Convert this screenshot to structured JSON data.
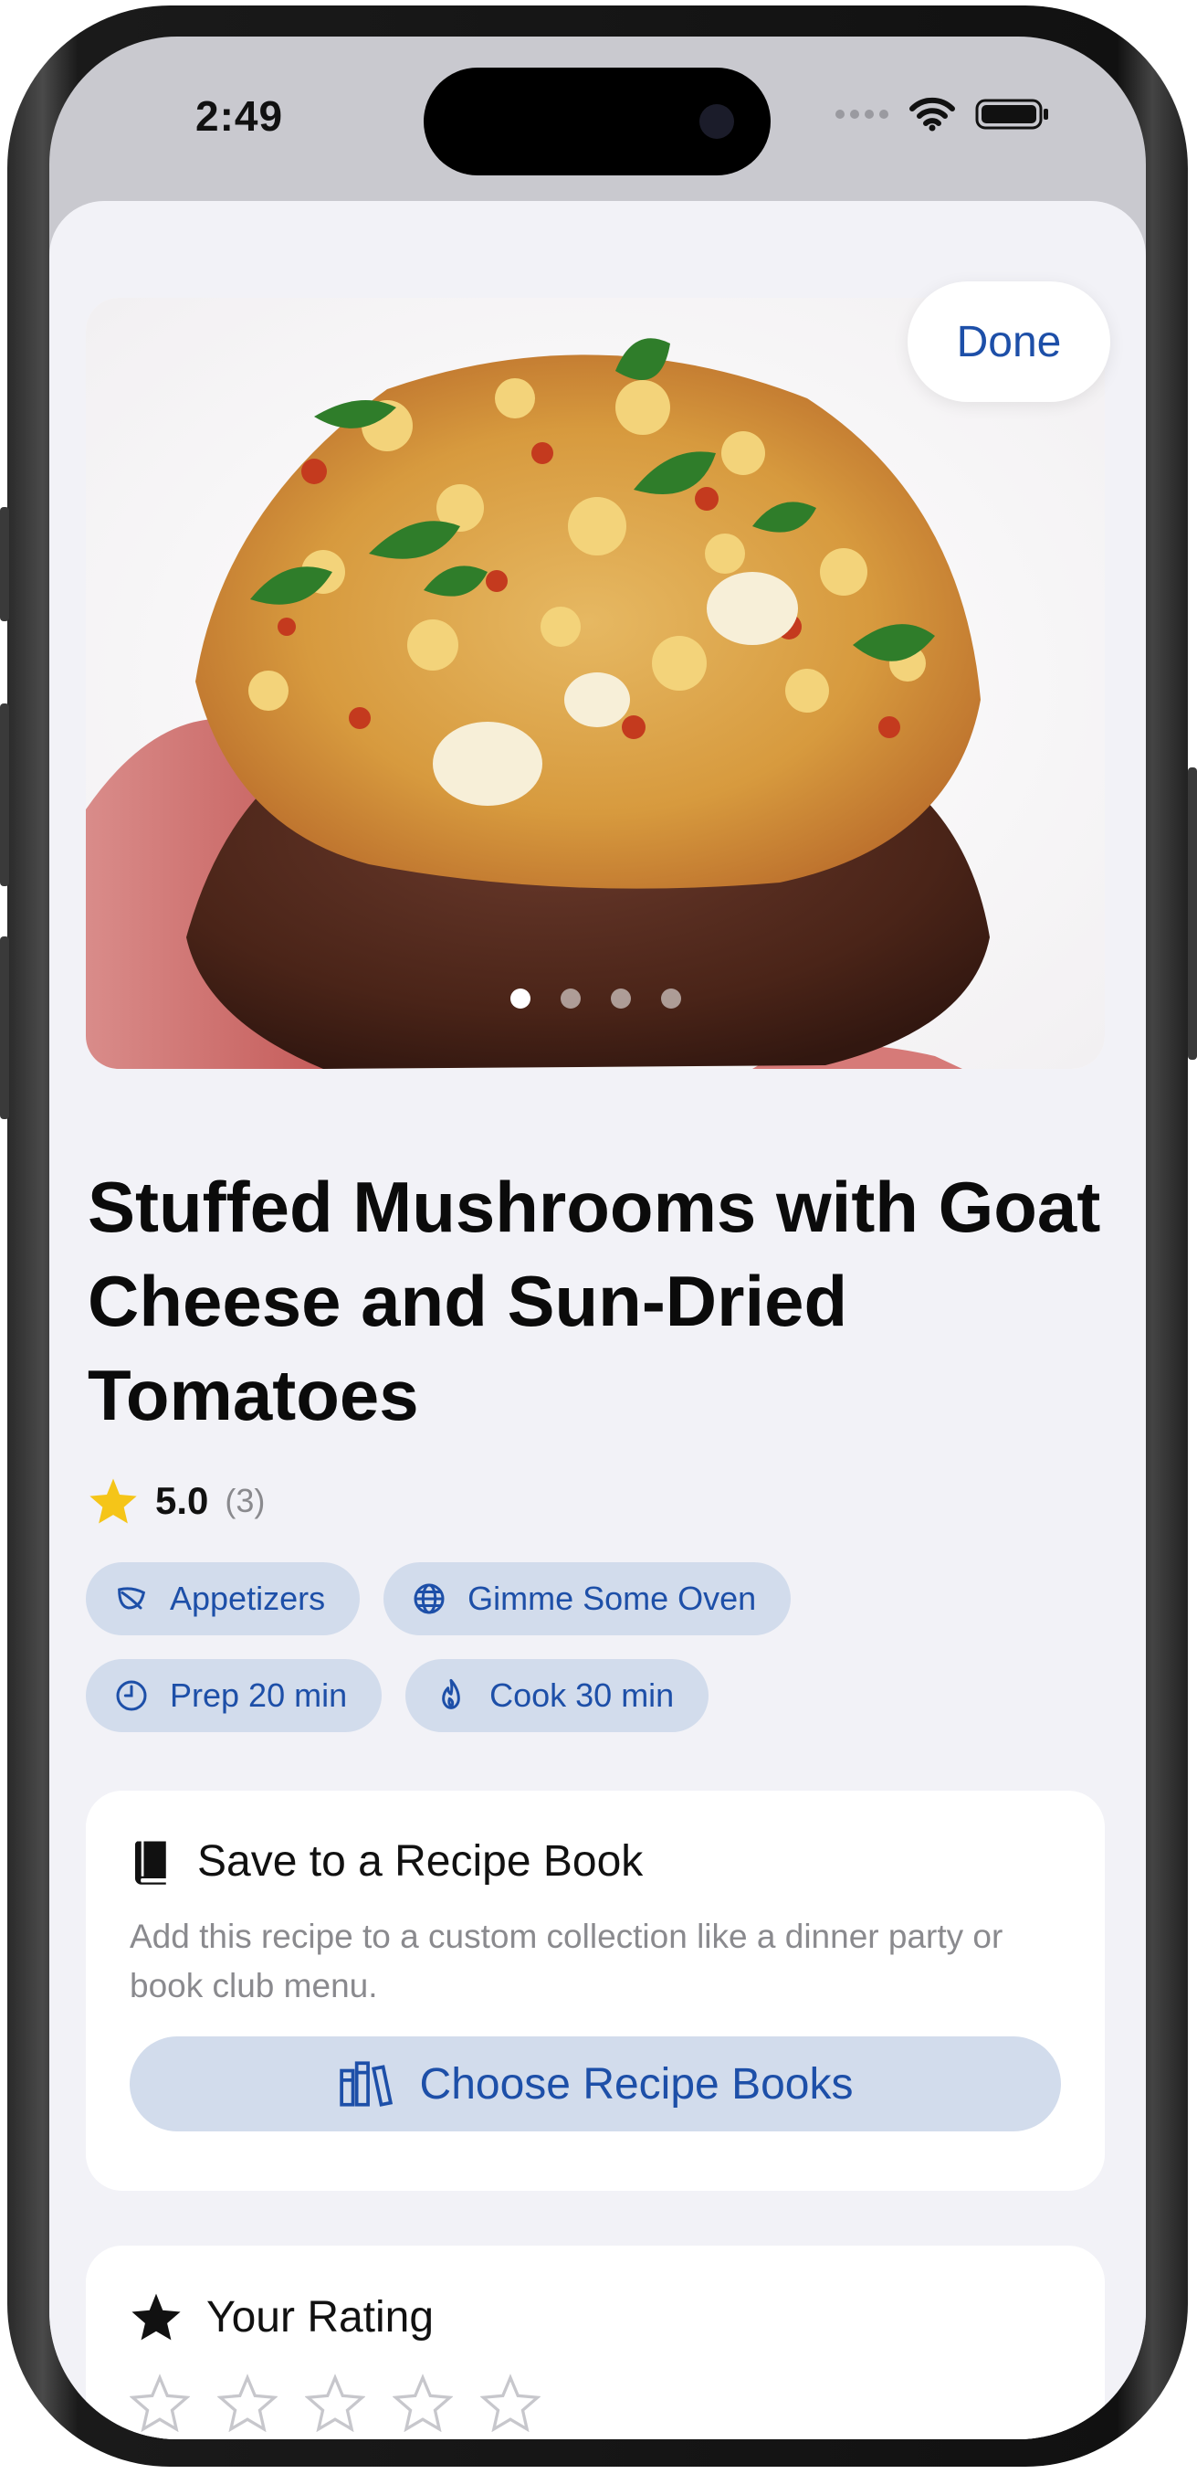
{
  "status_bar": {
    "time": "2:49"
  },
  "header": {
    "done_label": "Done"
  },
  "gallery": {
    "page_count": 4,
    "current_page": 1
  },
  "recipe": {
    "title": "Stuffed Mushrooms with Goat Cheese and Sun-Dried Tomatoes",
    "rating_value": "5.0",
    "rating_count": "(3)",
    "star_color": "#f5c518"
  },
  "chips": [
    {
      "icon": "leaf-icon",
      "label": "Appetizers"
    },
    {
      "icon": "globe-icon",
      "label": "Gimme Some Oven"
    },
    {
      "icon": "clock-icon",
      "label": "Prep 20 min"
    },
    {
      "icon": "flame-icon",
      "label": "Cook 30 min"
    }
  ],
  "recipe_book_card": {
    "title": "Save to a Recipe Book",
    "description": "Add this recipe to a custom collection like a dinner party or book club menu.",
    "button_label": "Choose Recipe Books"
  },
  "rating_card": {
    "title": "Your Rating",
    "star_count": 5,
    "current_rating": 0
  },
  "colors": {
    "accent": "#1d4fa8",
    "chip_bg": "#d2dcec",
    "sheet_bg": "#f2f2f7"
  }
}
